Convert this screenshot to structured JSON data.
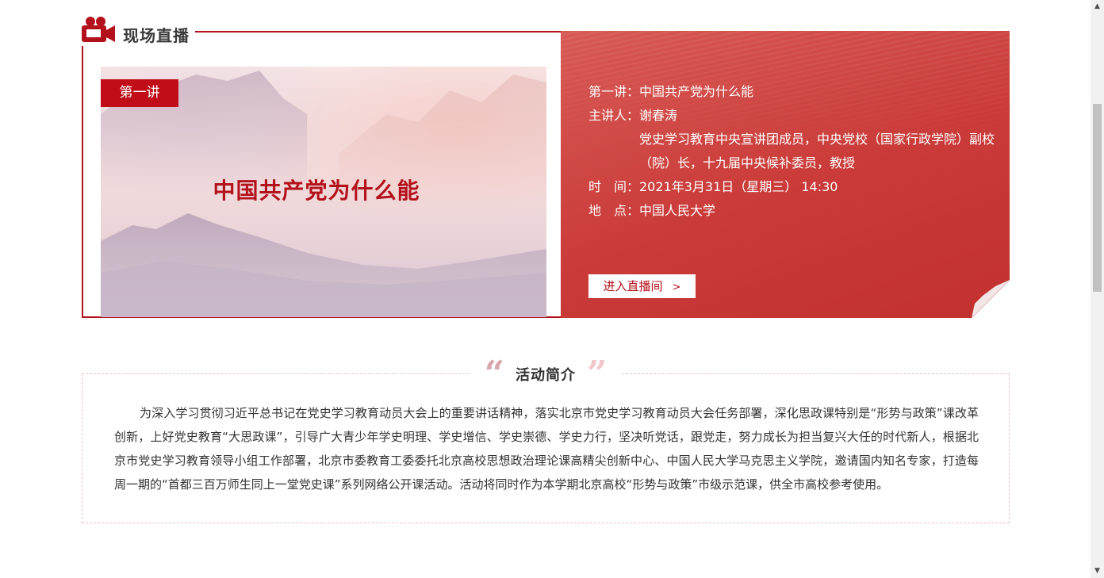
{
  "live_section": {
    "title": "现场直播"
  },
  "poster": {
    "badge": "第一讲",
    "title": "中国共产党为什么能"
  },
  "lecture_info": {
    "rows": [
      {
        "label": "第一讲：",
        "value": "中国共产党为什么能"
      },
      {
        "label": "主讲人：",
        "value": "谢春涛"
      },
      {
        "label": "",
        "value": "党史学习教育中央宣讲团成员，中央党校（国家行政学院）副校（院）长，十九届中央候补委员，教授"
      },
      {
        "label": "时　间：",
        "value": "2021年3月31日（星期三） 14:30"
      },
      {
        "label": "地　点：",
        "value": "中国人民大学"
      }
    ],
    "enter_label": "进入直播间",
    "enter_arrow": ">"
  },
  "intro": {
    "quote_open": "“",
    "title": "活动简介",
    "quote_close": "”",
    "body": "为深入学习贯彻习近平总书记在党史学习教育动员大会上的重要讲话精神，落实北京市党史学习教育动员大会任务部署，深化思政课特别是“形势与政策”课改革创新，上好党史教育“大思政课”，引导广大青少年学史明理、学史增信、学史崇德、学史力行，坚决听党话，跟党走，努力成长为担当复兴大任的时代新人，根据北京市党史学习教育领导小组工作部署，北京市委教育工委委托北京高校思想政治理论课高精尖创新中心、中国人民大学马克思主义学院，邀请国内知名专家，打造每周一期的“首都三百万师生同上一堂党史课”系列网络公开课活动。活动将同时作为本学期北京高校“形势与政策”市级示范课，供全市高校参考使用。"
  },
  "icons": {
    "camera": "video-camera-icon",
    "scroll_up": "scroll-up-arrow-icon",
    "scroll_down": "scroll-down-arrow-icon"
  },
  "colors": {
    "brand_red": "#b3111b",
    "badge_red": "#c00d18",
    "panel_red": "#c93a38",
    "dashed_border": "#ebc0c6"
  }
}
